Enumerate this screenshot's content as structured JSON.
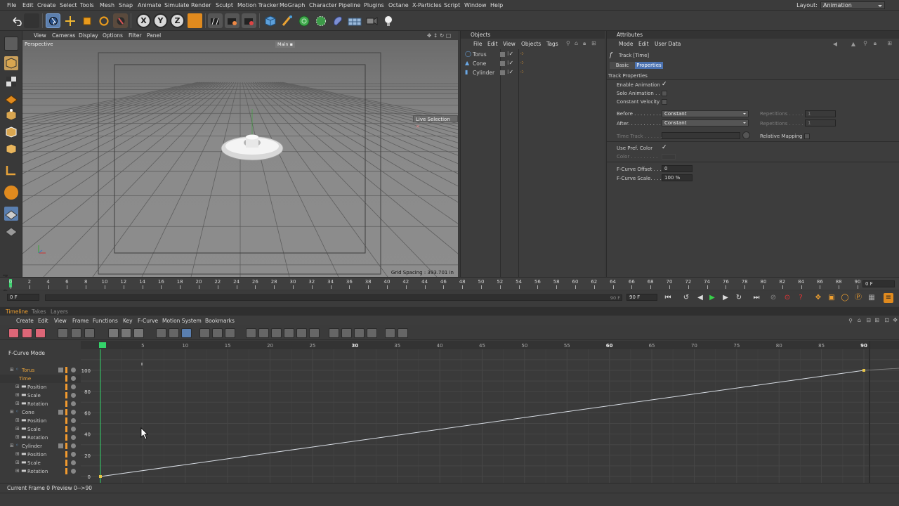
{
  "menu": {
    "items": [
      "File",
      "Edit",
      "Create",
      "Select",
      "Tools",
      "Mesh",
      "Snap",
      "Animate",
      "Simulate",
      "Render",
      "Sculpt",
      "Motion Tracker",
      "MoGraph",
      "Character",
      "Pipeline",
      "Plugins",
      "Octane",
      "X-Particles",
      "Script",
      "Window",
      "Help"
    ],
    "layout_label": "Layout:",
    "layout_value": "Animation"
  },
  "viewport": {
    "menu": [
      "View",
      "Cameras",
      "Display",
      "Options",
      "Filter",
      "Panel"
    ],
    "name": "Perspective",
    "camera_tag": "Main",
    "tool_tag": "Live Selection",
    "grid_spacing": "Grid Spacing : 393.701 in"
  },
  "toolbar": {
    "axis": [
      "X",
      "Y",
      "Z"
    ]
  },
  "objects": {
    "title": "Objects",
    "menu": [
      "File",
      "Edit",
      "View",
      "Objects",
      "Tags"
    ],
    "rows": [
      {
        "name": "Torus"
      },
      {
        "name": "Cone"
      },
      {
        "name": "Cylinder"
      }
    ]
  },
  "attributes": {
    "title": "Attributes",
    "menu": [
      "Mode",
      "Edit",
      "User Data"
    ],
    "track_title": "Track [Time]",
    "tabs": [
      "Basic",
      "Properties"
    ],
    "section": "Track Properties",
    "enable_animation": "Enable Animation",
    "solo_animation": "Solo Animation . .",
    "constant_velocity": "Constant Velocity",
    "before_label": "Before . . . . . . . . . .",
    "before_value": "Constant",
    "after_label": "After. . . . . . . . . . .",
    "after_value": "Constant",
    "repetitions1": "Repetitions . . . . .",
    "repetitions2": "Repetitions . . . . .",
    "rep_value": "1",
    "time_track": "Time Track . . . . . .",
    "relative_mapping": "Relative Mapping",
    "use_pref_color": "Use Pref. Color",
    "color": "Color . . . . . . . . .",
    "fcurve_offset": "F-Curve Offset . . .",
    "fcurve_offset_value": "0",
    "fcurve_scale": "F-Curve Scale. . . .",
    "fcurve_scale_value": "100 %"
  },
  "ruler": {
    "ticks": [
      "0",
      "2",
      "4",
      "6",
      "8",
      "10",
      "12",
      "14",
      "16",
      "18",
      "20",
      "22",
      "24",
      "26",
      "28",
      "30",
      "32",
      "34",
      "36",
      "38",
      "40",
      "42",
      "44",
      "46",
      "48",
      "50",
      "52",
      "54",
      "56",
      "58",
      "60",
      "62",
      "64",
      "66",
      "68",
      "70",
      "72",
      "74",
      "76",
      "78",
      "80",
      "82",
      "84",
      "86",
      "88",
      "90"
    ],
    "end_field": "0 F"
  },
  "playback": {
    "start": "0 F",
    "end_range": "90 F",
    "end": "90 F"
  },
  "timeline": {
    "tabs": [
      "Timeline",
      "Takes",
      "Layers"
    ],
    "menu": [
      "Create",
      "Edit",
      "View",
      "Frame",
      "Functions",
      "Key",
      "F-Curve",
      "Motion System",
      "Bookmarks"
    ],
    "mode": "F-Curve Mode",
    "tree": [
      {
        "label": "Torus",
        "indent": 0,
        "color": "#e8a33a"
      },
      {
        "label": "Time",
        "indent": 1,
        "color": "#e8a33a"
      },
      {
        "label": "Position",
        "indent": 2,
        "color": "#c9c9c9"
      },
      {
        "label": "Scale",
        "indent": 2,
        "color": "#c9c9c9"
      },
      {
        "label": "Rotation",
        "indent": 2,
        "color": "#c9c9c9"
      },
      {
        "label": "Cone",
        "indent": 0,
        "color": "#c9c9c9"
      },
      {
        "label": "Position",
        "indent": 2,
        "color": "#c9c9c9"
      },
      {
        "label": "Scale",
        "indent": 2,
        "color": "#c9c9c9"
      },
      {
        "label": "Rotation",
        "indent": 2,
        "color": "#c9c9c9"
      },
      {
        "label": "Cylinder",
        "indent": 0,
        "color": "#c9c9c9"
      },
      {
        "label": "Position",
        "indent": 2,
        "color": "#c9c9c9"
      },
      {
        "label": "Scale",
        "indent": 2,
        "color": "#c9c9c9"
      },
      {
        "label": "Rotation",
        "indent": 2,
        "color": "#c9c9c9"
      }
    ],
    "frame_ticks": [
      "0",
      "5",
      "10",
      "15",
      "20",
      "25",
      "30",
      "35",
      "40",
      "45",
      "50",
      "55",
      "60",
      "65",
      "70",
      "75",
      "80",
      "85",
      "90"
    ],
    "value_ticks": [
      "100",
      "80",
      "60",
      "40",
      "20",
      "0"
    ],
    "curve": {
      "start": [
        0,
        0
      ],
      "end": [
        90,
        100
      ]
    }
  },
  "status": {
    "text": "Current Frame  0  Preview  0-->90"
  },
  "colors": {
    "accent": "#f29a2e",
    "highlight": "#4a7fc6",
    "curve": "#d8dde4",
    "key": "#e7c547",
    "playhead": "#34d36a"
  }
}
